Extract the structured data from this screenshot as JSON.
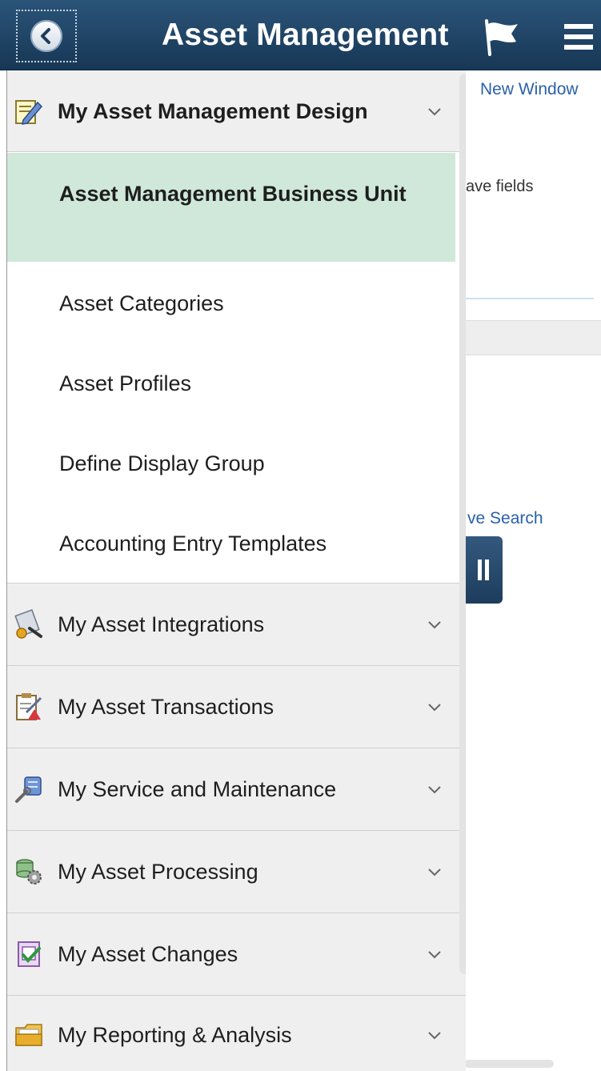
{
  "header": {
    "title": "Asset Management",
    "back_icon": "back-arrow-icon",
    "flag_icon": "flag-icon",
    "menu_icon": "hamburger-menu-icon",
    "colors": {
      "bar": "#1e4468",
      "selected_item": "#cfe8da",
      "group_bg": "#efefef",
      "link": "#2a61a8"
    }
  },
  "background_page": {
    "new_window_link": "New Window",
    "fields_text": "ave fields",
    "save_search_link": "ve Search"
  },
  "nav": {
    "expanded_group": {
      "label": "My Asset Management Design",
      "icon": "design-pencil-icon",
      "items": [
        {
          "label": "Asset Management Business Unit",
          "selected": true
        },
        {
          "label": "Asset Categories"
        },
        {
          "label": "Asset Profiles"
        },
        {
          "label": "Define Display Group"
        },
        {
          "label": "Accounting Entry Templates"
        }
      ]
    },
    "groups": [
      {
        "label": "My Asset Integrations",
        "icon": "integrations-icon"
      },
      {
        "label": "My Asset Transactions",
        "icon": "transactions-clipboard-icon"
      },
      {
        "label": "My Service and Maintenance",
        "icon": "service-maintenance-icon"
      },
      {
        "label": "My Asset Processing",
        "icon": "processing-gears-icon"
      },
      {
        "label": "My Asset Changes",
        "icon": "changes-checkmark-icon"
      },
      {
        "label": "My Reporting & Analysis",
        "icon": "reporting-folder-icon"
      }
    ]
  }
}
